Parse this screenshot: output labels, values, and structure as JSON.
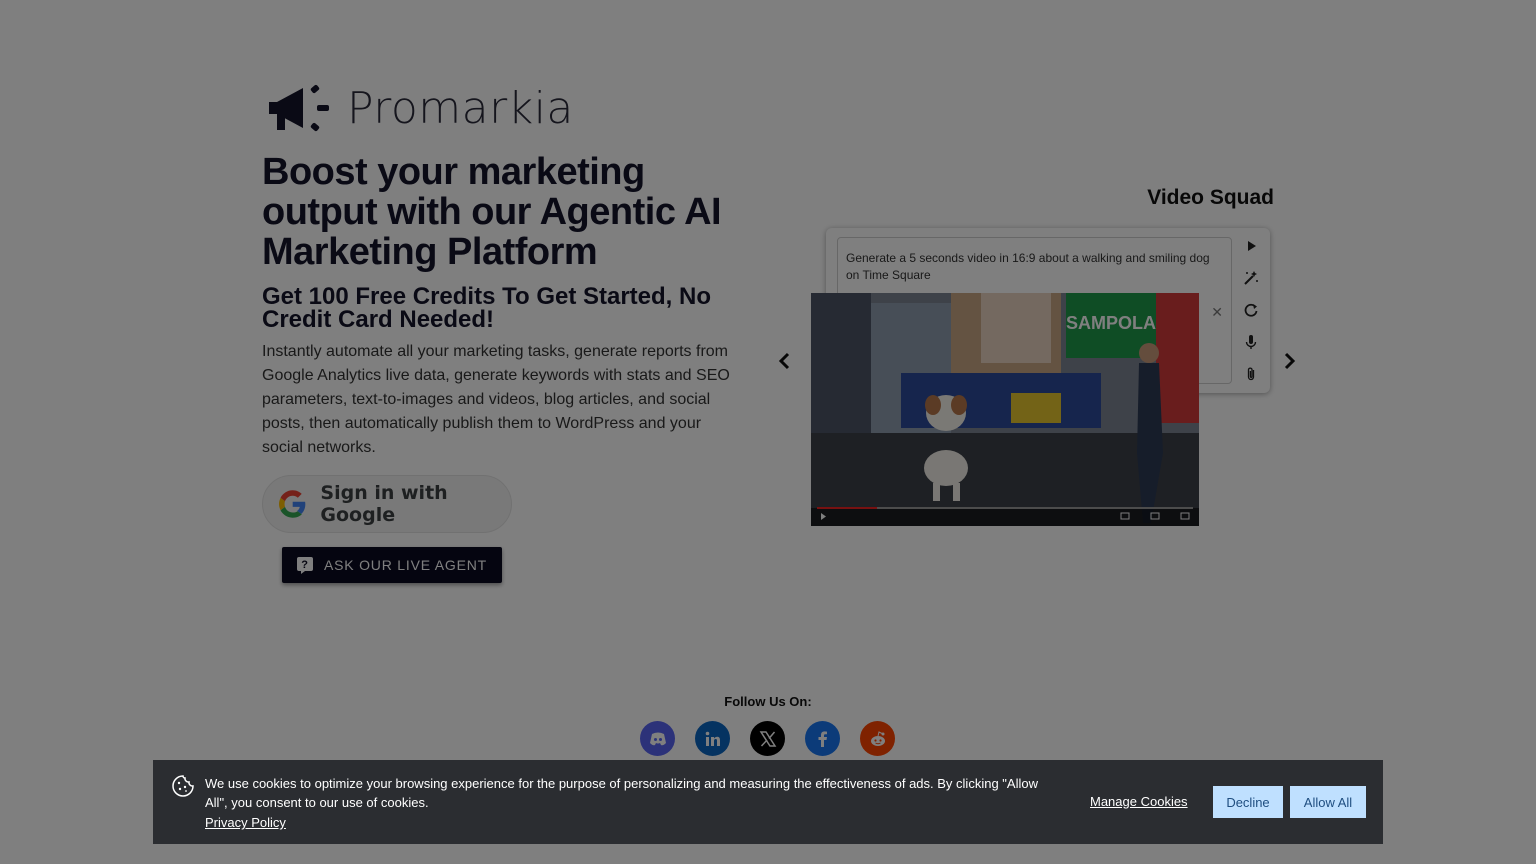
{
  "brand": {
    "name": "Promarkia"
  },
  "hero": {
    "title": "Boost your marketing output with our Agentic AI Marketing Platform",
    "subtitle": "Get 100 Free Credits To Get Started, No Credit Card Needed!",
    "description": "Instantly automate all your marketing tasks, generate reports from Google Analytics live data, generate keywords with stats and SEO parameters, text-to-images and videos, blog articles, and social posts, then automatically publish them to WordPress and your social networks.",
    "google_button": "Sign in with Google",
    "agent_button": "ASK OUR LIVE AGENT"
  },
  "carousel": {
    "slide_title": "Video Squad",
    "prompt_text": "Generate a 5 seconds video in 16:9 about a walking and smiling dog on Time Square",
    "close_glyph": "✕",
    "video_billboard": "SAMPOLA",
    "tools": [
      "play-icon",
      "magic-wand-icon",
      "refresh-icon",
      "microphone-icon",
      "attachment-icon"
    ]
  },
  "footer": {
    "follow_label": "Follow Us On:",
    "socials": [
      {
        "name": "discord",
        "color": "#5865F2"
      },
      {
        "name": "linkedin",
        "color": "#0A66C2"
      },
      {
        "name": "x",
        "color": "#000000"
      },
      {
        "name": "facebook",
        "color": "#1877F2"
      },
      {
        "name": "reddit",
        "color": "#FF4500"
      }
    ]
  },
  "cookie": {
    "text": "We use cookies to optimize your browsing experience for the purpose of personalizing and measuring the effectiveness of ads. By clicking \"Allow All\", you consent to our use of cookies.",
    "privacy_label": "Privacy Policy ",
    "manage_label": "Manage Cookies",
    "decline_label": "Decline",
    "allow_label": "Allow All"
  }
}
